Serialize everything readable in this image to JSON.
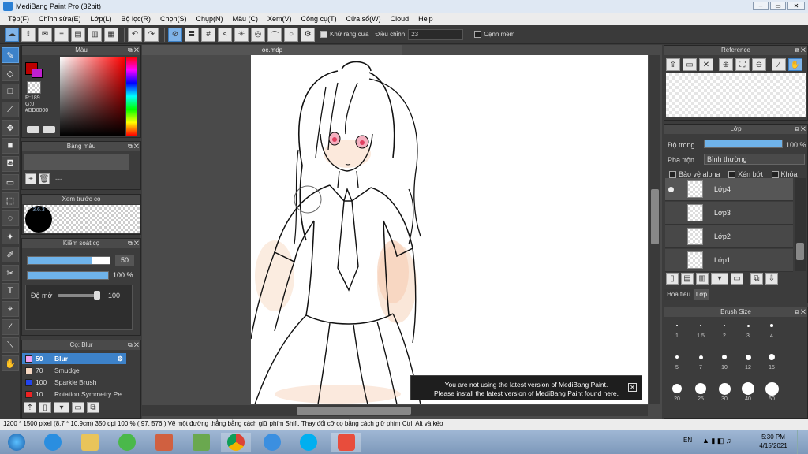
{
  "window": {
    "title": "MediBang Paint Pro (32bit)",
    "minimize": "–",
    "restore": "▭",
    "close": "✕"
  },
  "menu": [
    "Tệp(F)",
    "Chỉnh sửa(E)",
    "Lớp(L)",
    "Bộ lọc(R)",
    "Chọn(S)",
    "Chụp(N)",
    "Màu (C)",
    "Xem(V)",
    "Công cụ(T)",
    "Cửa sổ(W)",
    "Cloud",
    "Help"
  ],
  "toolbar": {
    "antialias_label": "Khử răng cưa",
    "correction_label": "Điều chỉnh",
    "correction_value": "23",
    "edge_label": "Cạnh mềm"
  },
  "color_panel": {
    "title": "Màu",
    "r": "R:189",
    "g": "G:0",
    "b": "B:0",
    "hex": "#BD0000",
    "primary": "#BD0000"
  },
  "palette_panel": {
    "title": "Bảng màu",
    "value": "---"
  },
  "brush_preview": {
    "title": "Xem trước cọ",
    "size": "3.6.3"
  },
  "brush_control": {
    "title": "Kiểm soát cọ",
    "size": "50",
    "opacity": "100 %",
    "blur_label": "Độ mờ",
    "blur_value": "100"
  },
  "brush_list": {
    "title": "Cọ: Blur",
    "items": [
      {
        "size": "50",
        "name": "Blur",
        "color": "#f0a0f0"
      },
      {
        "size": "70",
        "name": "Smudge",
        "color": "#f5d6c0"
      },
      {
        "size": "100",
        "name": "Sparkle Brush",
        "color": "#2244ee"
      },
      {
        "size": "10",
        "name": "Rotation Symmetry Pe",
        "color": "#ee2222"
      }
    ]
  },
  "document": {
    "tab": "oc.mdp"
  },
  "toast": {
    "line1": "You are not using the latest version of MediBang Paint.",
    "line2": "Please install the latest version of MediBang Paint found here."
  },
  "reference_panel": {
    "title": "Reference"
  },
  "layer_panel": {
    "title": "Lớp",
    "opacity_label": "Độ trong",
    "opacity_value": "100 %",
    "opacity_fraction": 1.0,
    "blend_label": "Pha trộn",
    "blend_value": "Bình thường",
    "protect_alpha": "Bảo vệ alpha",
    "clipping": "Xén bớt",
    "lock": "Khóa",
    "layers": [
      "Lớp4",
      "Lớp3",
      "Lớp2",
      "Lớp1"
    ],
    "tab_material": "Hoa tiêu",
    "tab_layer": "Lớp"
  },
  "brush_size_panel": {
    "title": "Brush Size",
    "sizes": [
      "1",
      "1.5",
      "2",
      "3",
      "4",
      "5",
      "7",
      "10",
      "12",
      "15",
      "20",
      "25",
      "30",
      "40",
      "50"
    ]
  },
  "status": {
    "text": "1200 * 1500 pixel   (8.7 * 10.9cm)   350 dpi   100 %   ( 97, 576 )   Vẽ một đường thẳng bằng cách giữ phím Shift, Thay đổi cỡ cọ bằng cách giữ phím Ctrl, Alt và kéo"
  },
  "taskbar": {
    "lang": "EN",
    "time": "5:30 PM",
    "date": "4/15/2021"
  }
}
